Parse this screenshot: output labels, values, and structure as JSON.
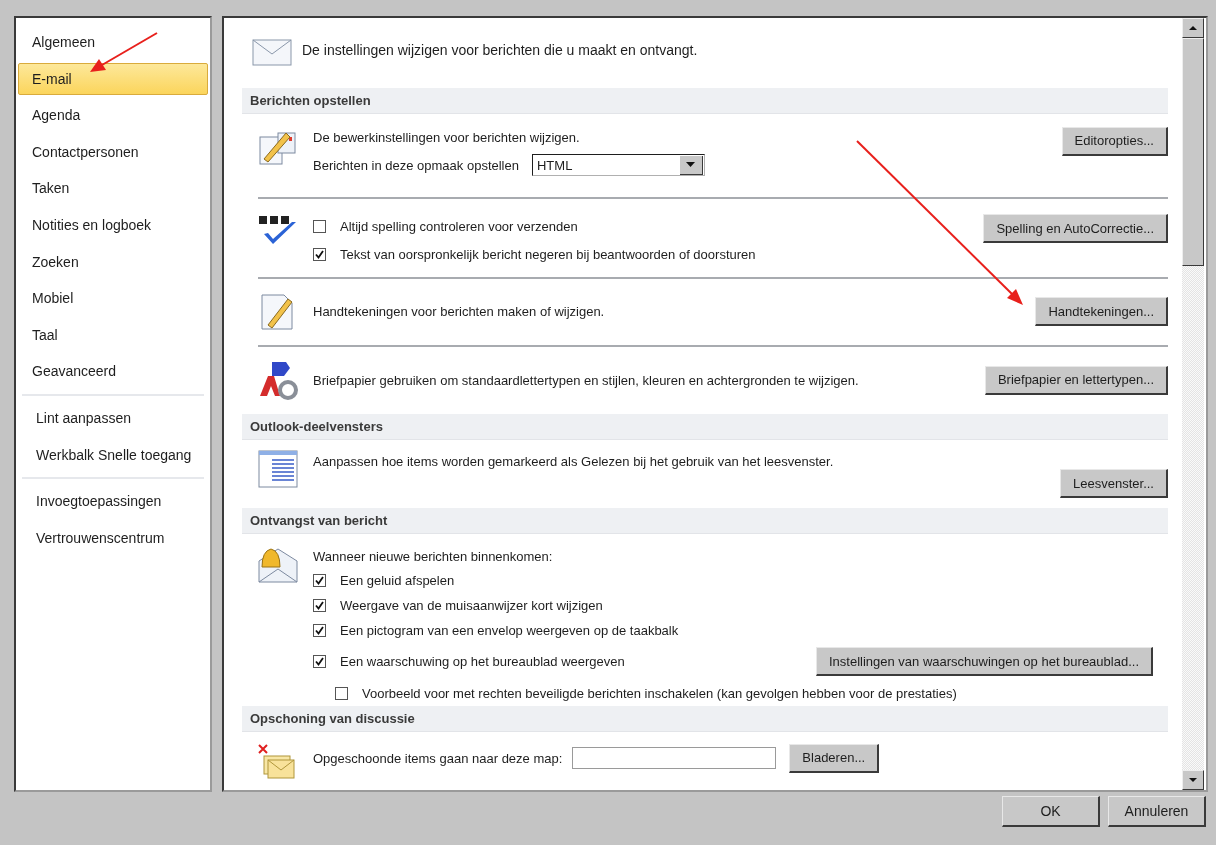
{
  "sidebar": {
    "groups": [
      {
        "items": [
          {
            "label": "Algemeen",
            "selected": false
          },
          {
            "label": "E-mail",
            "selected": true
          },
          {
            "label": "Agenda",
            "selected": false
          },
          {
            "label": "Contactpersonen",
            "selected": false
          },
          {
            "label": "Taken",
            "selected": false
          },
          {
            "label": "Notities en logboek",
            "selected": false
          },
          {
            "label": "Zoeken",
            "selected": false
          },
          {
            "label": "Mobiel",
            "selected": false
          },
          {
            "label": "Taal",
            "selected": false
          },
          {
            "label": "Geavanceerd",
            "selected": false
          }
        ]
      },
      {
        "items": [
          {
            "label": "Lint aanpassen",
            "selected": false
          },
          {
            "label": "Werkbalk Snelle toegang",
            "selected": false
          }
        ]
      },
      {
        "items": [
          {
            "label": "Invoegtoepassingen",
            "selected": false
          },
          {
            "label": "Vertrouwenscentrum",
            "selected": false
          }
        ]
      }
    ]
  },
  "intro": "De instellingen wijzigen voor berichten die u maakt en ontvangt.",
  "sections": [
    {
      "title": "Berichten opstellen",
      "blocks": [
        {
          "kind": "editor",
          "button": "Editoropties...",
          "rows": [
            {
              "kind": "text",
              "text": "De bewerkinstellingen voor berichten wijzigen."
            },
            {
              "kind": "select",
              "label": "Berichten in deze opmaak opstellen",
              "value": "HTML"
            }
          ]
        },
        {
          "kind": "spelling",
          "button": "Spelling en AutoCorrectie...",
          "rows": [
            {
              "kind": "checkbox",
              "label": "Altijd spelling controleren voor verzenden",
              "checked": false
            },
            {
              "kind": "checkbox",
              "label": "Tekst van oorspronkelijk bericht negeren bij beantwoorden of doorsturen",
              "checked": true
            }
          ]
        },
        {
          "kind": "signature",
          "button": "Handtekeningen...",
          "rows": [
            {
              "kind": "text",
              "text": "Handtekeningen voor berichten maken of wijzigen."
            }
          ]
        },
        {
          "kind": "stationery",
          "button": "Briefpapier en lettertypen...",
          "rows": [
            {
              "kind": "text",
              "text": "Briefpapier gebruiken om standaardlettertypen en stijlen, kleuren en achtergronden te wijzigen."
            }
          ]
        }
      ]
    },
    {
      "title": "Outlook-deelvensters",
      "blocks": [
        {
          "kind": "reading-pane",
          "button": "Leesvenster...",
          "rows": [
            {
              "kind": "text",
              "text": "Aanpassen hoe items worden gemarkeerd als Gelezen bij het gebruik van het leesvenster."
            }
          ]
        }
      ]
    },
    {
      "title": "Ontvangst van bericht",
      "blocks": [
        {
          "kind": "arrival",
          "rows": [
            {
              "kind": "text",
              "text": "Wanneer nieuwe berichten binnenkomen:"
            },
            {
              "kind": "checkbox",
              "label": "Een geluid afspelen",
              "checked": true
            },
            {
              "kind": "checkbox",
              "label": "Weergave van de muisaanwijzer kort wijzigen",
              "checked": true
            },
            {
              "kind": "checkbox",
              "label": "Een pictogram van een envelop weergeven op de taakbalk",
              "checked": true
            },
            {
              "kind": "checkbox",
              "label": "Een waarschuwing op het bureaublad weergeven",
              "checked": true,
              "button": "Instellingen van waarschuwingen op het bureaublad...",
              "children": [
                {
                  "kind": "checkbox",
                  "label": "Voorbeeld voor met rechten beveiligde berichten inschakelen (kan gevolgen hebben voor de prestaties)",
                  "checked": false
                }
              ]
            }
          ]
        }
      ]
    },
    {
      "title": "Opschoning van discussie",
      "blocks": [
        {
          "kind": "cleanup",
          "rows": [
            {
              "kind": "folder",
              "label": "Opgeschoonde items gaan naar deze map:",
              "button": "Bladeren..."
            }
          ]
        }
      ]
    }
  ],
  "buttons": [
    "OK",
    "Annuleren"
  ]
}
